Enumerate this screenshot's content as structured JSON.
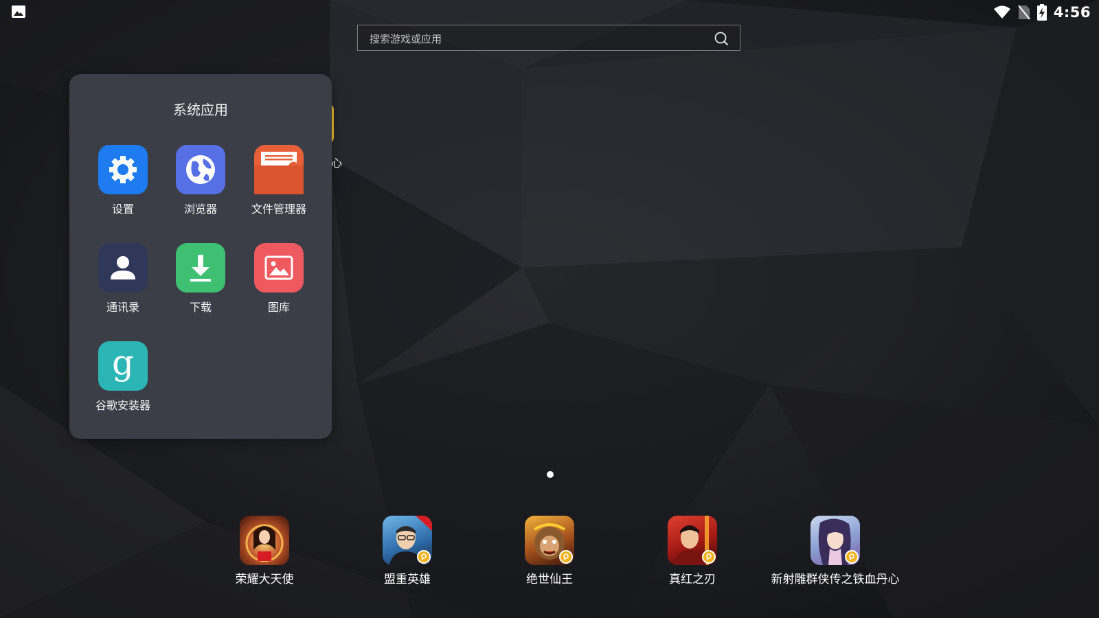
{
  "status_bar": {
    "time": "4:56",
    "icons": [
      "image-notification-icon",
      "wifi-icon",
      "no-sim-icon",
      "battery-charging-icon"
    ]
  },
  "search": {
    "placeholder": "搜索游戏或应用",
    "icon": "search-icon"
  },
  "background_item": {
    "label_fragment": "心"
  },
  "folder": {
    "title": "系统应用",
    "apps": [
      {
        "label": "设置",
        "icon": "gear-icon",
        "color": "#1e7bf0"
      },
      {
        "label": "浏览器",
        "icon": "globe-icon",
        "color": "#5770e6"
      },
      {
        "label": "文件管理器",
        "icon": "file-manager-icon",
        "color": "#e8603a"
      },
      {
        "label": "通讯录",
        "icon": "contacts-icon",
        "color": "#30385a"
      },
      {
        "label": "下载",
        "icon": "download-icon",
        "color": "#3fbf72"
      },
      {
        "label": "图库",
        "icon": "gallery-icon",
        "color": "#ee5a60"
      },
      {
        "label": "谷歌安装器",
        "icon": "google-installer-icon",
        "color": "#2bb5b5"
      }
    ]
  },
  "page_indicator": {
    "current": 1,
    "total": 1
  },
  "dock": {
    "apps": [
      {
        "label": "荣耀大天使",
        "icon": "game-icon-1"
      },
      {
        "label": "盟重英雄",
        "icon": "game-icon-2"
      },
      {
        "label": "绝世仙王",
        "icon": "game-icon-3"
      },
      {
        "label": "真红之刃",
        "icon": "game-icon-4"
      },
      {
        "label": "新射雕群侠传之铁血丹心",
        "icon": "game-icon-5"
      }
    ]
  }
}
